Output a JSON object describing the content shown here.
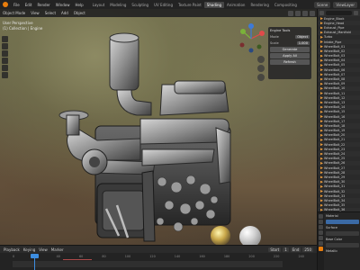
{
  "app": {
    "menu": [
      "File",
      "Edit",
      "Render",
      "Window",
      "Help"
    ],
    "workspaces": [
      "Layout",
      "Modeling",
      "Sculpting",
      "UV Editing",
      "Texture Paint",
      "Shading",
      "Animation",
      "Rendering",
      "Compositing",
      "Geometry Nodes",
      "Scripting"
    ],
    "active_workspace": "Shading",
    "scene": "Scene",
    "view_layer": "ViewLayer"
  },
  "viewport": {
    "header_menu": [
      "Object Mode",
      "View",
      "Select",
      "Add",
      "Object"
    ],
    "info_lines": [
      "User Perspective",
      "(1) Collection | Engine"
    ],
    "accent": "#e87d0d"
  },
  "n_panel": {
    "title": "Engine Tools",
    "rows": [
      {
        "label": "Mode",
        "value": "Object"
      },
      {
        "label": "Scale",
        "value": "1.000"
      }
    ],
    "buttons": [
      "Generate",
      "Apply All",
      "Refresh"
    ]
  },
  "outliner": {
    "rows": [
      "Engine_Block",
      "Engine_Head",
      "Exhaust_Pipe",
      "Exhaust_Manifold",
      "Turbo",
      "Intake_Pipe",
      "WheelBolt_01",
      "WheelBolt_02",
      "WheelBolt_03",
      "WheelBolt_04",
      "WheelBolt_05",
      "WheelBolt_06",
      "WheelBolt_07",
      "WheelBolt_08",
      "WheelBolt_09",
      "WheelBolt_10",
      "WheelBolt_11",
      "WheelBolt_12",
      "WheelBolt_13",
      "WheelBolt_14",
      "WheelBolt_15",
      "WheelBolt_16",
      "WheelBolt_17",
      "WheelBolt_18",
      "WheelBolt_19",
      "WheelBolt_20",
      "WheelBolt_21",
      "WheelBolt_22",
      "WheelBolt_23",
      "WheelBolt_24",
      "WheelBolt_25",
      "WheelBolt_26",
      "WheelBolt_27",
      "WheelBolt_28",
      "WheelBolt_29",
      "WheelBolt_30",
      "WheelBolt_31",
      "WheelBolt_32",
      "WheelBolt_33",
      "WheelBolt_34",
      "WheelBolt_35",
      "WheelBolt_36"
    ]
  },
  "properties": {
    "section": "Material",
    "lines": [
      "Surface",
      "Base Color",
      "Metallic"
    ]
  },
  "timeline": {
    "menu": [
      "Playback",
      "Keying",
      "View",
      "Marker"
    ],
    "ruler": [
      "0",
      "20",
      "40",
      "60",
      "80",
      "100",
      "120",
      "140",
      "160",
      "180",
      "200",
      "220",
      "240"
    ],
    "start_label": "Start",
    "start": "1",
    "end_label": "End",
    "end": "250"
  }
}
